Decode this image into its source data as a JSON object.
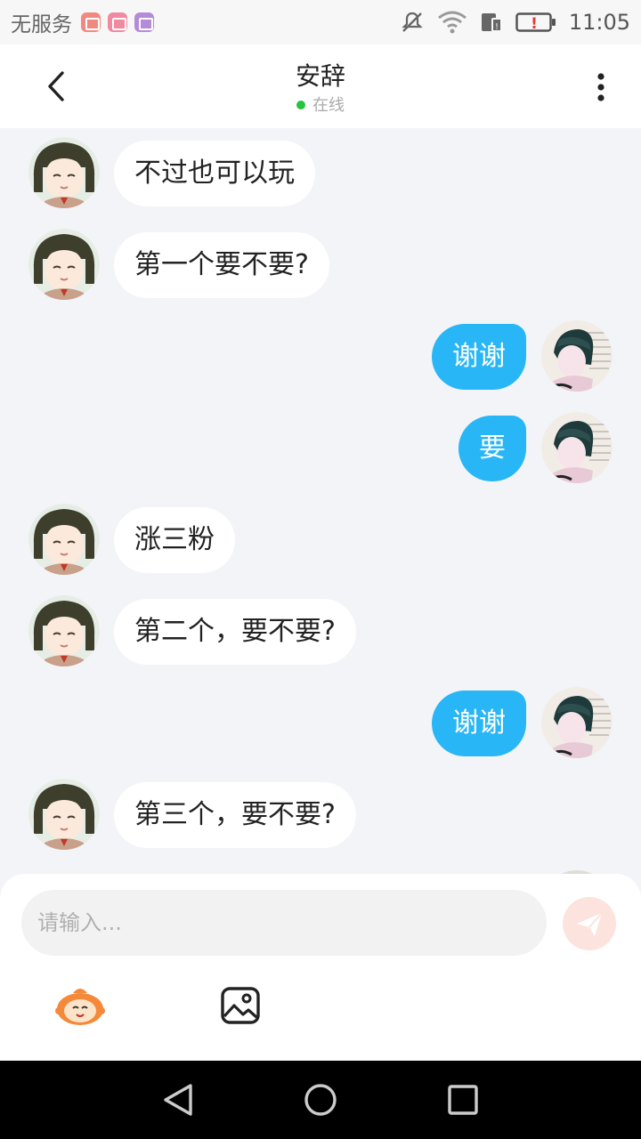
{
  "status_bar": {
    "carrier": "无服务",
    "time": "11:05",
    "notification_icons": [
      "mail-icon",
      "phone-icon",
      "gallery-icon"
    ],
    "system_icons": [
      "mute-icon",
      "wifi-icon",
      "sim-icon",
      "battery-alert-icon"
    ]
  },
  "header": {
    "title": "安辞",
    "status": "在线",
    "status_color": "#26c43a",
    "back_icon": "chevron-left-icon",
    "more_icon": "more-vertical-icon"
  },
  "messages": [
    {
      "side": "left",
      "text": "不过也可以玩"
    },
    {
      "side": "left",
      "text": "第一个要不要?"
    },
    {
      "side": "right",
      "text": "谢谢"
    },
    {
      "side": "right",
      "text": "要"
    },
    {
      "side": "left",
      "text": "涨三粉"
    },
    {
      "side": "left",
      "text": "第二个，要不要?"
    },
    {
      "side": "right",
      "text": "谢谢"
    },
    {
      "side": "left",
      "text": "第三个，要不要?"
    }
  ],
  "composer": {
    "placeholder": "请输入...",
    "send_icon": "send-icon",
    "emoji_icon": "emoji-mascot-icon",
    "image_icon": "image-icon"
  },
  "colors": {
    "outgoing_bubble": "#29b6f6",
    "incoming_bubble": "#ffffff",
    "background": "#f3f4f8",
    "send_button": "#fde3dd"
  },
  "nav_bar": {
    "icons": [
      "back-triangle-icon",
      "home-circle-icon",
      "recents-square-icon"
    ]
  }
}
